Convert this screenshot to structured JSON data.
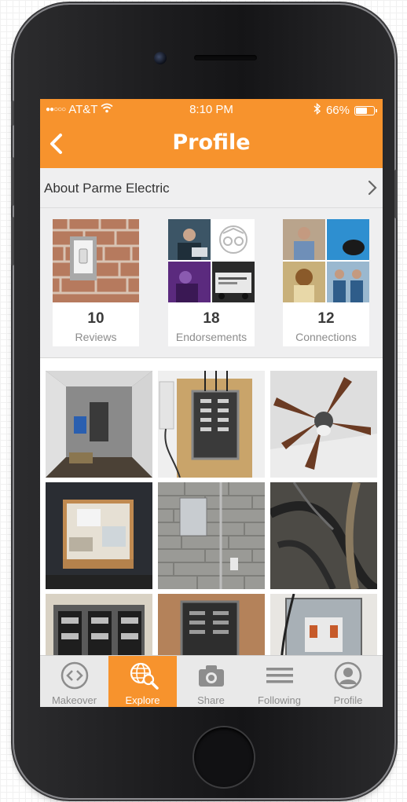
{
  "status_bar": {
    "signal_dots": "●●○○○",
    "carrier": "AT&T",
    "time": "8:10 PM",
    "battery_text": "66%",
    "battery_level": 0.66
  },
  "nav": {
    "title": "Profile",
    "back_icon": "chevron-left-icon"
  },
  "about_row": {
    "label": "About Parme Electric",
    "chevron_icon": "chevron-right-icon"
  },
  "stats": [
    {
      "count": "10",
      "label": "Reviews"
    },
    {
      "count": "18",
      "label": "Endorsements"
    },
    {
      "count": "12",
      "label": "Connections"
    }
  ],
  "photos": [
    "trailer-interior",
    "electrical-panel-wood",
    "ceiling-fan",
    "window-frame-room",
    "gray-brick-wall-boxes",
    "conduit-cables",
    "breaker-panel-row",
    "open-breaker-panel",
    "meter-socket"
  ],
  "tabs": [
    {
      "label": "Makeover",
      "icon": "makeover-icon",
      "active": false
    },
    {
      "label": "Explore",
      "icon": "globe-search-icon",
      "active": true
    },
    {
      "label": "Share",
      "icon": "camera-icon",
      "active": false
    },
    {
      "label": "Following",
      "icon": "list-icon",
      "active": false
    },
    {
      "label": "Profile",
      "icon": "profile-icon",
      "active": false
    }
  ],
  "colors": {
    "accent": "#f7932d",
    "tab_bar": "#e9e9e9"
  }
}
